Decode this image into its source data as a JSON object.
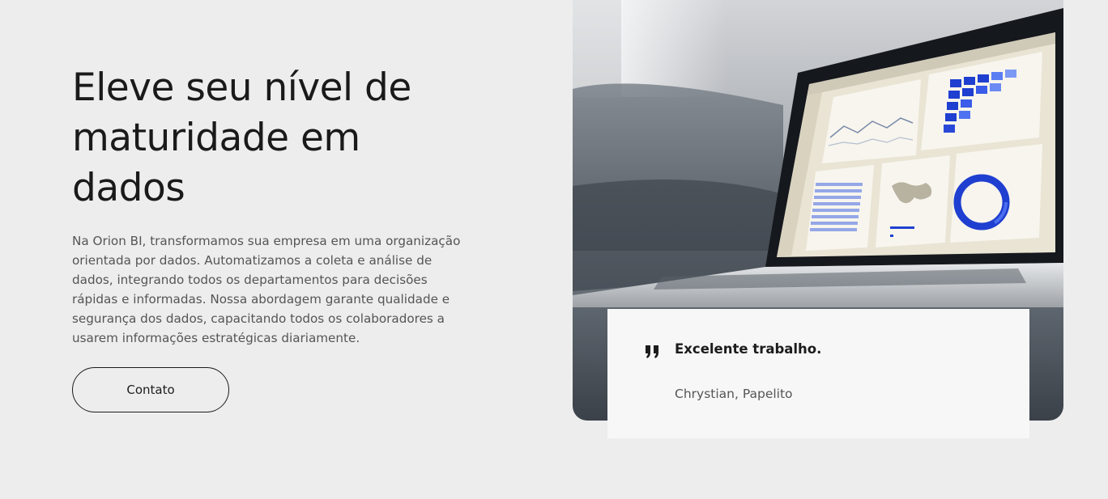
{
  "hero": {
    "headline": "Eleve seu nível de maturidade em dados",
    "description": "Na Orion BI, transformamos sua empresa em uma organização orientada por dados. Automatizamos a coleta e análise de dados, integrando todos os departamentos para decisões rápidas e informadas. Nossa abordagem garante qualidade e segurança dos dados, capacitando todos os colaboradores a usarem informações estratégicas diariamente.",
    "cta_label": "Contato"
  },
  "testimonial": {
    "quote": "Excelente trabalho.",
    "author": "Chrystian, Papelito",
    "icon": "quote-icon"
  },
  "colors": {
    "page_background": "#ededed",
    "text": "#1c1c1c",
    "card_background": "#f7f7f7",
    "dashboard_blue": "#1f3fd0"
  }
}
